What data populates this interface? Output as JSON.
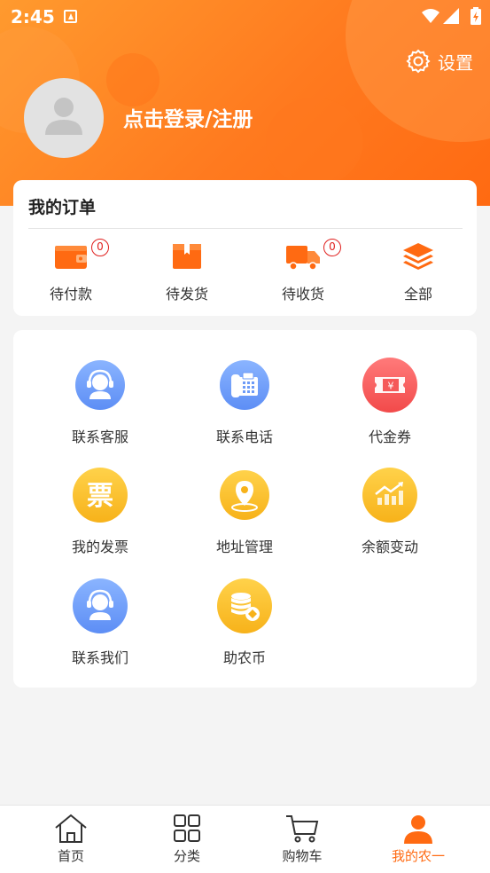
{
  "status_bar": {
    "time": "2:45"
  },
  "header": {
    "settings_label": "设置",
    "login_label": "点击登录/注册"
  },
  "orders": {
    "title": "我的订单",
    "items": [
      {
        "label": "待付款",
        "icon": "wallet-icon",
        "badge": "0"
      },
      {
        "label": "待发货",
        "icon": "box-icon"
      },
      {
        "label": "待收货",
        "icon": "truck-icon",
        "badge": "0"
      },
      {
        "label": "全部",
        "icon": "layers-icon"
      }
    ]
  },
  "services": {
    "items": [
      {
        "label": "联系客服",
        "icon": "customer-service-icon",
        "color": "#6d9bf7"
      },
      {
        "label": "联系电话",
        "icon": "telephone-icon",
        "color": "#6d9bf7"
      },
      {
        "label": "代金券",
        "icon": "voucher-icon",
        "color": "#f55a5a"
      },
      {
        "label": "我的发票",
        "icon": "invoice-icon",
        "glyph": "票",
        "color": "#f9bd2a"
      },
      {
        "label": "地址管理",
        "icon": "location-pin-icon",
        "color": "#f9bd2a"
      },
      {
        "label": "余额变动",
        "icon": "trend-chart-icon",
        "color": "#f9bd2a"
      },
      {
        "label": "联系我们",
        "icon": "support-agent-icon",
        "color": "#6d9bf7"
      },
      {
        "label": "助农币",
        "icon": "coin-stack-icon",
        "color": "#f9bd2a"
      }
    ],
    "voucher_glyph": "¥"
  },
  "tabbar": {
    "items": [
      {
        "label": "首页",
        "icon": "home-icon",
        "active": false
      },
      {
        "label": "分类",
        "icon": "grid-icon",
        "active": false
      },
      {
        "label": "购物车",
        "icon": "cart-icon",
        "active": false
      },
      {
        "label": "我的农一",
        "icon": "user-icon",
        "active": true
      }
    ]
  },
  "colors": {
    "accent": "#ff6a12",
    "badge": "#e0201e",
    "blue": "#6d9bf7",
    "yellow": "#f9bd2a",
    "red": "#f55a5a"
  }
}
